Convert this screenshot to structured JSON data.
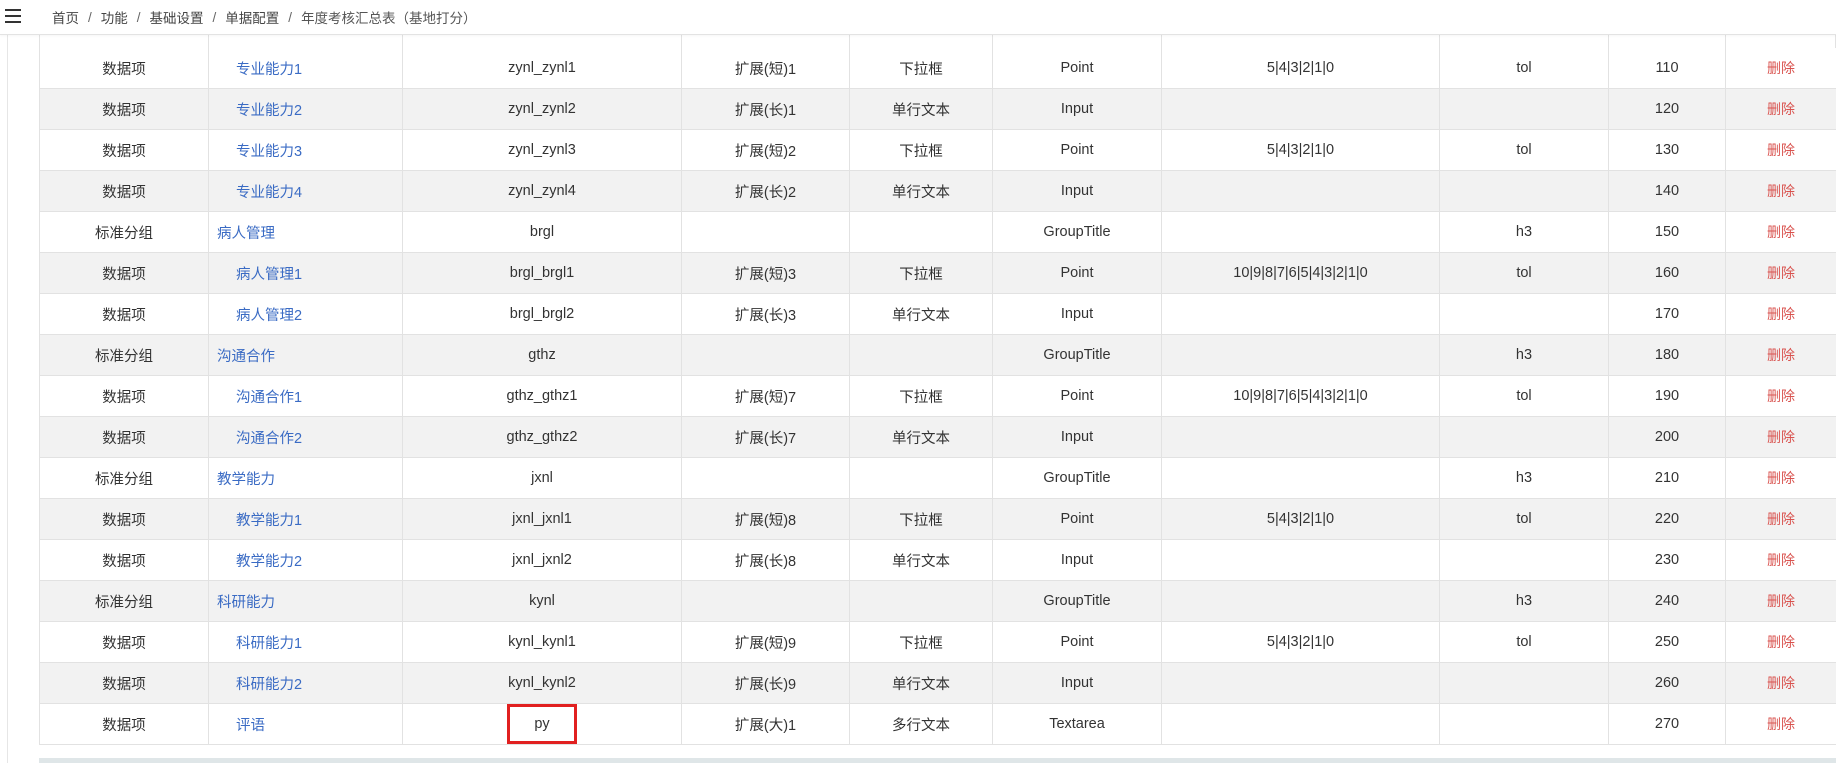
{
  "breadcrumb": [
    "首页",
    "功能",
    "基础设置",
    "单据配置",
    "年度考核汇总表（基地打分）"
  ],
  "rows": [
    {
      "type": "数据项",
      "name": "专业能力1",
      "code": "zynl_zynl1",
      "field": "扩展(短)1",
      "control": "下拉框",
      "ctype": "Point",
      "options": "5|4|3|2|1|0",
      "extra": "tol",
      "order": "110",
      "action": "删除"
    },
    {
      "type": "数据项",
      "name": "专业能力2",
      "code": "zynl_zynl2",
      "field": "扩展(长)1",
      "control": "单行文本",
      "ctype": "Input",
      "options": "",
      "extra": "",
      "order": "120",
      "action": "删除"
    },
    {
      "type": "数据项",
      "name": "专业能力3",
      "code": "zynl_zynl3",
      "field": "扩展(短)2",
      "control": "下拉框",
      "ctype": "Point",
      "options": "5|4|3|2|1|0",
      "extra": "tol",
      "order": "130",
      "action": "删除"
    },
    {
      "type": "数据项",
      "name": "专业能力4",
      "code": "zynl_zynl4",
      "field": "扩展(长)2",
      "control": "单行文本",
      "ctype": "Input",
      "options": "",
      "extra": "",
      "order": "140",
      "action": "删除"
    },
    {
      "type": "标准分组",
      "name": "病人管理",
      "code": "brgl",
      "field": "",
      "control": "",
      "ctype": "GroupTitle",
      "options": "",
      "extra": "h3",
      "order": "150",
      "action": "删除"
    },
    {
      "type": "数据项",
      "name": "病人管理1",
      "code": "brgl_brgl1",
      "field": "扩展(短)3",
      "control": "下拉框",
      "ctype": "Point",
      "options": "10|9|8|7|6|5|4|3|2|1|0",
      "extra": "tol",
      "order": "160",
      "action": "删除"
    },
    {
      "type": "数据项",
      "name": "病人管理2",
      "code": "brgl_brgl2",
      "field": "扩展(长)3",
      "control": "单行文本",
      "ctype": "Input",
      "options": "",
      "extra": "",
      "order": "170",
      "action": "删除"
    },
    {
      "type": "标准分组",
      "name": "沟通合作",
      "code": "gthz",
      "field": "",
      "control": "",
      "ctype": "GroupTitle",
      "options": "",
      "extra": "h3",
      "order": "180",
      "action": "删除"
    },
    {
      "type": "数据项",
      "name": "沟通合作1",
      "code": "gthz_gthz1",
      "field": "扩展(短)7",
      "control": "下拉框",
      "ctype": "Point",
      "options": "10|9|8|7|6|5|4|3|2|1|0",
      "extra": "tol",
      "order": "190",
      "action": "删除"
    },
    {
      "type": "数据项",
      "name": "沟通合作2",
      "code": "gthz_gthz2",
      "field": "扩展(长)7",
      "control": "单行文本",
      "ctype": "Input",
      "options": "",
      "extra": "",
      "order": "200",
      "action": "删除"
    },
    {
      "type": "标准分组",
      "name": "教学能力",
      "code": "jxnl",
      "field": "",
      "control": "",
      "ctype": "GroupTitle",
      "options": "",
      "extra": "h3",
      "order": "210",
      "action": "删除"
    },
    {
      "type": "数据项",
      "name": "教学能力1",
      "code": "jxnl_jxnl1",
      "field": "扩展(短)8",
      "control": "下拉框",
      "ctype": "Point",
      "options": "5|4|3|2|1|0",
      "extra": "tol",
      "order": "220",
      "action": "删除"
    },
    {
      "type": "数据项",
      "name": "教学能力2",
      "code": "jxnl_jxnl2",
      "field": "扩展(长)8",
      "control": "单行文本",
      "ctype": "Input",
      "options": "",
      "extra": "",
      "order": "230",
      "action": "删除"
    },
    {
      "type": "标准分组",
      "name": "科研能力",
      "code": "kynl",
      "field": "",
      "control": "",
      "ctype": "GroupTitle",
      "options": "",
      "extra": "h3",
      "order": "240",
      "action": "删除"
    },
    {
      "type": "数据项",
      "name": "科研能力1",
      "code": "kynl_kynl1",
      "field": "扩展(短)9",
      "control": "下拉框",
      "ctype": "Point",
      "options": "5|4|3|2|1|0",
      "extra": "tol",
      "order": "250",
      "action": "删除"
    },
    {
      "type": "数据项",
      "name": "科研能力2",
      "code": "kynl_kynl2",
      "field": "扩展(长)9",
      "control": "单行文本",
      "ctype": "Input",
      "options": "",
      "extra": "",
      "order": "260",
      "action": "删除"
    },
    {
      "type": "数据项",
      "name": "评语",
      "code": "py",
      "field": "扩展(大)1",
      "control": "多行文本",
      "ctype": "Textarea",
      "options": "",
      "extra": "",
      "order": "270",
      "action": "删除",
      "highlighted": true
    }
  ],
  "colors": {
    "link": "#3a6bc4",
    "delete": "#d9534f",
    "highlight": "#e12020",
    "stripe": "#f2f2f2"
  },
  "icons": {
    "menu": "hamburger-menu-icon"
  }
}
